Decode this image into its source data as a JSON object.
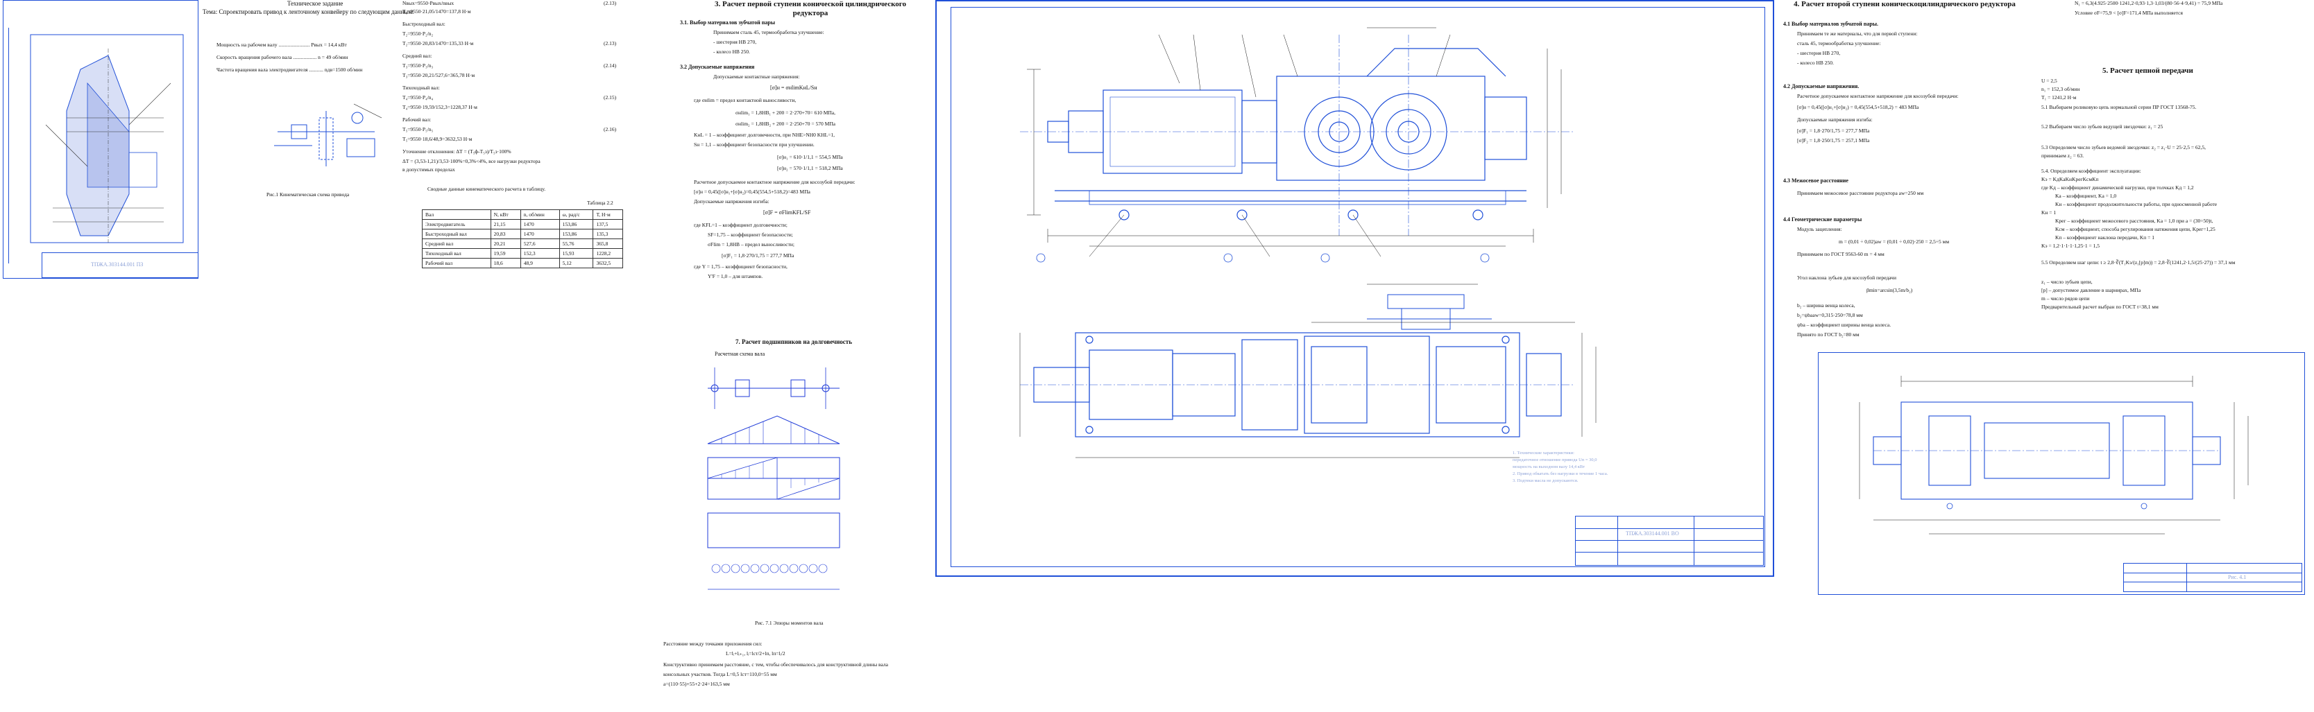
{
  "page1": {
    "task_title": "Техническое задание",
    "task_text": "Тема: Спроектировать привод к ленточному конвейеру по следующим данным:",
    "params": [
      "Мощность на рабочем валу ........................ Pвых = 14,4 кВт",
      "Скорость вращения рабочего вала .................. n = 49 об/мин",
      "Частота вращения вала электродвигателя ........... nдв=1500 об/мин"
    ],
    "fig_caption": "Рис.1 Кинематическая схема привода",
    "stamp_text": "ТПЖА.303144.001 ПЗ"
  },
  "page2": {
    "formulas": [
      "Nвых=9550·Pвых/nвых",
      "Т₁=9550·21,05/1470=137,8 Н·м",
      "Быстроходный вал:",
      "Т₂=9550·Р₂/n₂",
      "Т₂=9550·20,83/1470=135,33 Н·м",
      "Средний вал:",
      "Т₃=9550·Р₃/n₃",
      "Т₃=9550·20,21/527,6=365,78 Н·м",
      "Тихоходный вал:",
      "Т₄=9550·Р₄/n₄",
      "Т₄=9550·19,59/152,3=1228,37 Н·м",
      "Рабочий вал:",
      "Т₅=9550·Р₅/n₅",
      "Т₅=9550·18,6/48,9=3632,53 Н·м",
      "Уточнение отклонения: ΔТ = (Т₅ф-Т₅з)/Т₅з·100%",
      "ΔТ = (3,53-1,21)/3,53·100%=0,3%<4%, все нагрузки редуктора",
      "в допустимых пределах"
    ],
    "eq_numbers": [
      "(2.13)",
      "(2.13)",
      "(2.14)",
      "(2.15)",
      "(2.16)"
    ],
    "table_caption": "Сводные данные кинематического расчета в таблицу.",
    "table_tag": "Таблица 2.2",
    "table_headers": [
      "Вал",
      "N, кВт",
      "n, об/мин",
      "ω, рад/с",
      "Т, Н·м"
    ],
    "table_rows": [
      [
        "Электродвигатель",
        "21,15",
        "1470",
        "153,86",
        "137,5"
      ],
      [
        "Быстроходный вал",
        "20,83",
        "1470",
        "153,86",
        "135,3"
      ],
      [
        "Средний вал",
        "20,21",
        "527,6",
        "55,76",
        "365,8"
      ],
      [
        "Тихоходный вал",
        "19,59",
        "152,3",
        "15,93",
        "1228,2"
      ],
      [
        "Рабочий вал",
        "18,6",
        "48,9",
        "5,12",
        "3632,5"
      ]
    ]
  },
  "page3": {
    "heading": "3. Расчет первой ступени конической цилиндрического редуктора",
    "s31": "3.1. Выбор материалов зубчатой пары",
    "s31_lines": [
      "Принимаем сталь 45, термообработка улучшение:",
      "- шестерня НВ 270,",
      "- колесо НВ 250."
    ],
    "s32": "3.2 Допускаемые напряжения",
    "s32_lines": [
      "Допускаемые контактные напряжения:",
      "[σ]н = σнlimKнL/Sн",
      "где σнlim = предел контактной выносливости,",
      "σнlim₁ = 1,8НВ₁ + 200 = 2·270+70= 610 МПа,",
      "σнlim₂ = 1,8НВ₂ + 200 = 2·250+70 = 570 МПа",
      "KнL = 1 – коэффициент долговечности, при NHE>NH0 KHL=1,",
      "Sн = 1,1 – коэффициент безопасности при улучшении.",
      "[σ]н₁ = 610·1/1,1 = 554,5 МПа",
      "[σ]н₂ = 570·1/1,1 = 518,2 МПа",
      "Расчетное допускаемое контактное напряжение для косозубой передачи:",
      "[σ]н = 0,45([σ]н₁+[σ]н₂)=0,45(554,5+518,2)=483 МПа",
      "Допускаемые напряжения изгиба:",
      "[σ]F = σFlimKFL/SF",
      "где KFL=1 – коэффициент долговечности;",
      "SF=1,75 – коэффициент безопасности;",
      "σFlim = 1,8HB – предел выносливости;",
      "[σ]F₁ = 1,8·270/1,75 = 277,7 МПа",
      "где Y = 1,75 – коэффициент безопасности,",
      "Y'F = 1,0 – для штампов."
    ],
    "s7": "7. Расчет подшипников на долговечность",
    "s7_sub": "Расчетная схема вала",
    "fig_caption": "Рис. 7.1 Эпюры моментов вала",
    "bottom_lines": [
      "Расстояние между точками приложения сил:",
      "L=lᵢ+lᵢ₊₁, lᵢ=lст/2+lп, lп=lᵢ/2",
      "Конструктивно принимаем расстояние, с тем, чтобы обеспечивалось для конструктивной длины вала",
      "консольных участков. Тогда L=0,5 lст=110,0=55 мм",
      "a=(110·55)+55+2·24=163,5 мм"
    ]
  },
  "drawing": {
    "notes": [
      "1. Технические характеристики:",
      "передаточное отношение привода Uп = 30,0",
      "мощность на выходном валу 14,4 кВт",
      "2. Привод обкатать без нагрузки в течение 1 часа.",
      "3. Подтеки масла не допускаются."
    ],
    "stamp_title": "ТПЖА.303144.001 ВО"
  },
  "page5": {
    "heading": "4. Расчет второй ступени коническоцилиндрического редуктора",
    "s41": "4.1 Выбор материалов зубчатой пары.",
    "s41_lines": [
      "Принимаем те же материалы, что для первой ступени:",
      "сталь 45, термообработка улучшение:",
      "- шестерня НВ 270,",
      "- колесо НВ 250."
    ],
    "s42": "4.2 Допускаемые напряжения.",
    "s42_lines": [
      "Расчетное допускаемое контактное напряжение для косозубой передачи:",
      "[σ]н = 0,45([σ]н₁+[σ]н₂) = 0,45(554,5+518,2) = 483 МПа",
      "Допускаемые напряжения изгиба:",
      "[σ]F₁ = 1,8·270/1,75 = 277,7 МПа",
      "[σ]F₂ = 1,8·250/1,75 = 257,1 МПа"
    ],
    "s43": "4.3 Межосевое расстояние",
    "s43_lines": [
      "Принимаем межосевое расстояние редуктора aw=250 мм"
    ],
    "s44": "4.4 Геометрические параметры",
    "s44_lines": [
      "Модуль зацепления:",
      "m = (0,01 ÷ 0,02)aw = (0,01 ÷ 0,02)·250 = 2,5÷5 мм",
      "Принимаем по ГОСТ 9563-60 m = 4 мм",
      "Угол наклона зубьев для косозубой передачи",
      "βmin=arcsin(3,5m/b₂)",
      "b₂ – ширина венца колеса,",
      "b₂=ψbaaw=0,315·250=78,8 мм",
      "ψba – коэффициент ширины венца колеса.",
      "Принято по ГОСТ b₂=80 мм"
    ],
    "sketch_caption": "Рис. 4.1"
  },
  "page6": {
    "top_lines": [
      "N₁ = 6,3(4.925·2500·1241,2·0,93·1,3·1,03/(80·56·4·9,41) = 75,9 МПа",
      "Условие σF=75,9 < [σ]F=171,4 МПа выполняется"
    ],
    "heading": "5. Расчет цепной передачи",
    "lines": [
      "U = 2,5",
      "n₁ = 152,3 об/мин",
      "T₁ = 1241,2 Н·м",
      "5.1 Выбираем роликовую цепь нормальной серии ПР ГОСТ 13568-75.",
      "5.2 Выбираем число зубьев ведущей звездочки: z₁ = 25",
      "5.3 Определяем число зубьев ведомой звездочки: z₂ = z₁·U = 25·2,5 = 62,5,",
      "принимаем z₂ = 63.",
      "5.4. Определяем коэффициент эксплуатации:",
      "Kэ = KдKаKнKрегKсмKп",
      "где Kд – коэффициент динамической нагрузки, при толчках  Kд = 1,2",
      "Kа – коэффициент, Kа = 1,0",
      "Kн – коэффициент продолжительности работы, при односменной работе",
      "Kн = 1",
      "Kрег – коэффициент межосевого расстояния, Kа = 1,0 при a = (30÷50)t,",
      "Kсм – коэффициент, способа регулирования натяжения цепи, Kрег=1,25",
      "Kп – коэффициент наклона передачи, Kп = 1",
      "Kэ = 1,2·1·1·1·1,25·1 = 1,5",
      "5.5 Определяем шаг цепи: t ≥ 2,8·∛(T₁Kэ/(z₁[p]m)) = 2,8·∛(1241,2·1,5/(25·27)) = 37,1 мм",
      "z₁ – число зубьев цепи,",
      "[p] – допустимое давление в шарнирах, МПа",
      "m – число рядов цепи",
      "Предварительный расчет выбран по ГОСТ t=38,1 мм"
    ]
  }
}
